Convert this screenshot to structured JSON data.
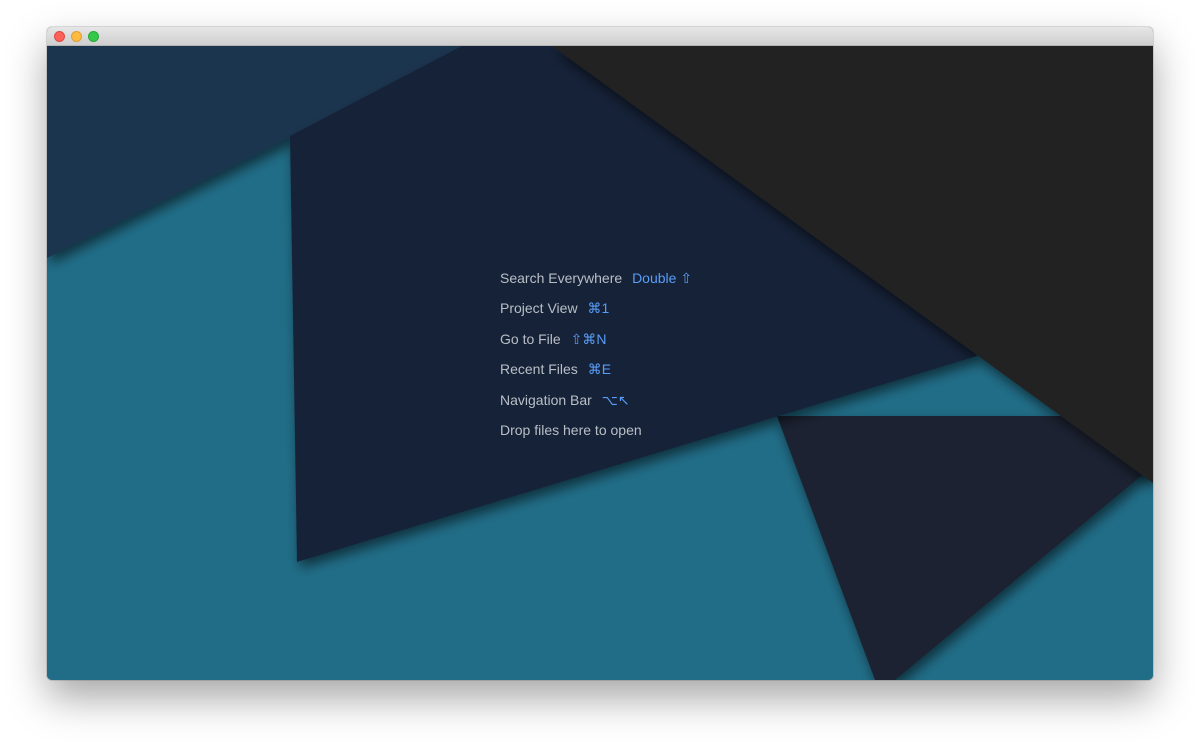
{
  "window": {
    "buttons": {
      "close": "close-button",
      "minimize": "minimize-button",
      "zoom": "zoom-button"
    }
  },
  "colors": {
    "background_teal": "#216d87",
    "navy_shape": "#1a3450",
    "deep_navy_shape": "#152437",
    "charcoal_shape": "#222222",
    "dark_slate_shape": "#1d2430",
    "label_text": "#b9bfc6",
    "shortcut_text": "#589df6"
  },
  "hints": [
    {
      "label": "Search Everywhere",
      "shortcut": "Double ⇧"
    },
    {
      "label": "Project View",
      "shortcut": "⌘1"
    },
    {
      "label": "Go to File",
      "shortcut": "⇧⌘N"
    },
    {
      "label": "Recent Files",
      "shortcut": "⌘E"
    },
    {
      "label": "Navigation Bar",
      "shortcut": "⌥↖"
    },
    {
      "label": "Drop files here to open",
      "shortcut": ""
    }
  ]
}
